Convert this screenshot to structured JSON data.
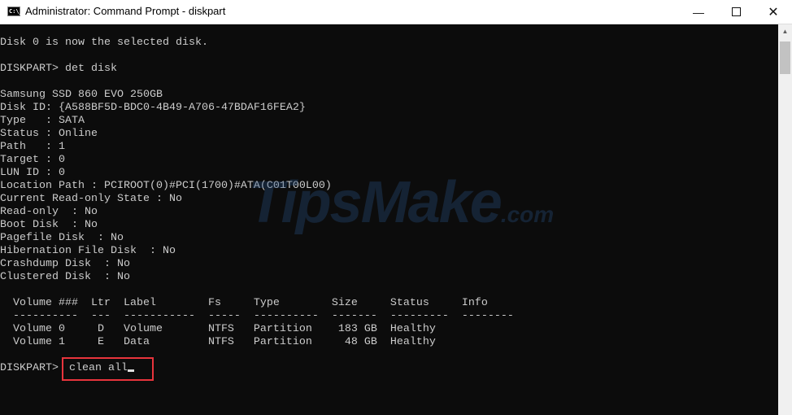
{
  "window": {
    "title": "Administrator: Command Prompt - diskpart",
    "icon_text": "C:\\_",
    "minimize_icon": "minimize-icon",
    "maximize_icon": "maximize-icon",
    "close_icon": "close-icon"
  },
  "console": {
    "lines": [
      "Disk 0 is now the selected disk.",
      "",
      "DISKPART> det disk",
      "",
      "Samsung SSD 860 EVO 250GB",
      "Disk ID: {A588BF5D-BDC0-4B49-A706-47BDAF16FEA2}",
      "Type   : SATA",
      "Status : Online",
      "Path   : 1",
      "Target : 0",
      "LUN ID : 0",
      "Location Path : PCIROOT(0)#PCI(1700)#ATA(C01T00L00)",
      "Current Read-only State : No",
      "Read-only  : No",
      "Boot Disk  : No",
      "Pagefile Disk  : No",
      "Hibernation File Disk  : No",
      "Crashdump Disk  : No",
      "Clustered Disk  : No",
      "",
      "  Volume ###  Ltr  Label        Fs     Type        Size     Status     Info",
      "  ----------  ---  -----------  -----  ----------  -------  ---------  --------",
      "  Volume 0     D   Volume       NTFS   Partition    183 GB  Healthy",
      "  Volume 1     E   Data         NTFS   Partition     48 GB  Healthy",
      ""
    ],
    "prompt": "DISKPART> ",
    "current_command": "clean all"
  },
  "watermark": {
    "main": "TipsMake",
    "suffix": ".com"
  }
}
